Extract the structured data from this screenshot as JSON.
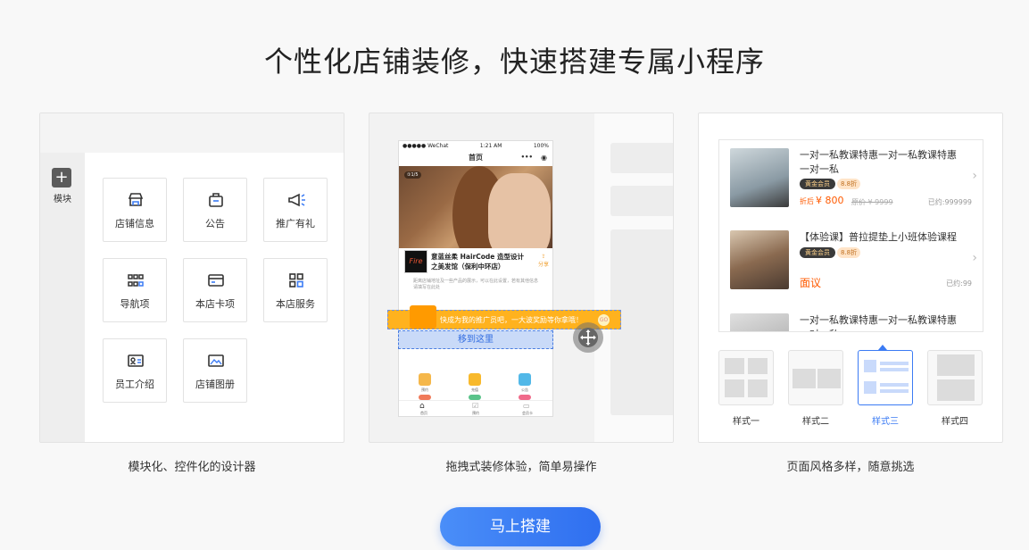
{
  "header": {
    "title": "个性化店铺装修，快速搭建专属小程序"
  },
  "card1": {
    "sidebar_label": "模块",
    "modules": [
      "店铺信息",
      "公告",
      "推广有礼",
      "导航项",
      "本店卡项",
      "本店服务",
      "员工介绍",
      "店铺图册"
    ],
    "caption": "模块化、控件化的设计器"
  },
  "card2": {
    "phone": {
      "status_left": "●●●●● WeChat",
      "status_time": "1:21 AM",
      "status_right": "100%",
      "title": "首页",
      "photo_tag": "①1/5",
      "shop_name": "意蓝丝柔 HairCode 造型设计之美发馆（保利中环店）",
      "shop_desc": "距离店铺地址及一些产品的展示，可以在此设置，若有其他信息请填写在此处",
      "share": "分享",
      "logo_text": "Fire",
      "grid_labels": [
        "预约",
        "充值",
        "公告"
      ],
      "tabs": [
        "首页",
        "预约",
        "会员卡"
      ]
    },
    "banner_text": "快成为我的推广员吧，一大波奖励等你拿哦！",
    "banner_go": "GO",
    "dropzone_text": "移到这里",
    "caption": "拖拽式装修体验，简单易操作"
  },
  "card3": {
    "items": [
      {
        "title": "一对一私教课特惠一对一私教课特惠一对一私",
        "badge": "黄金会员",
        "discount": "8.8折",
        "price_prefix": "折后",
        "price": "¥ 800",
        "orig": "原价 ¥ 9999",
        "sold": "已约:999999"
      },
      {
        "title": "【体验课】普拉提垫上小班体验课程",
        "badge": "黄金会员",
        "discount": "8.8折",
        "price": "面议",
        "sold": "已约:99"
      },
      {
        "title": "一对一私教课特惠一对一私教课特惠一对一私"
      }
    ],
    "styles": [
      "样式一",
      "样式二",
      "样式三",
      "样式四"
    ],
    "selected_style": 2,
    "caption": "页面风格多样，随意挑选"
  },
  "cta": {
    "label": "马上搭建"
  },
  "colors": {
    "accent": "#3b7bf4",
    "price": "#ff5a00",
    "banner": "#ffb21e"
  }
}
